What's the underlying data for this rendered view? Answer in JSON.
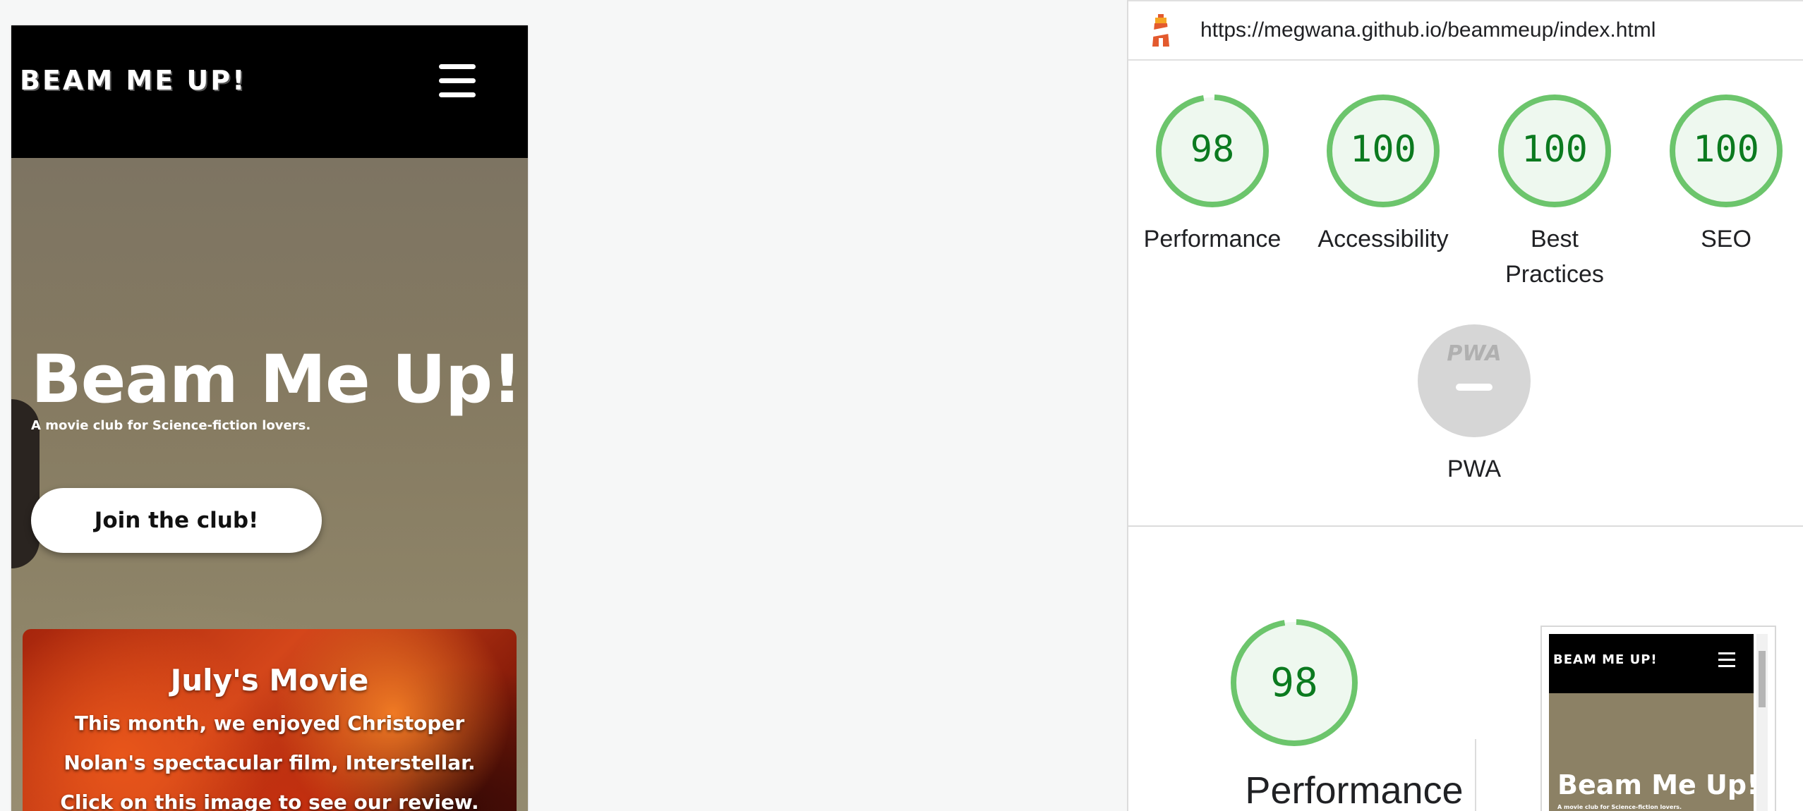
{
  "site": {
    "logo": "BEAM ME UP!",
    "hero": {
      "title": "Beam Me Up!",
      "subtitle": "A movie club for Science-fiction lovers.",
      "cta_label": "Join the club!"
    },
    "movie_card": {
      "title": "July's Movie",
      "text": "This month, we enjoyed Christoper Nolan's spectacular film, Interstellar. Click on this image to see our review."
    }
  },
  "report": {
    "url": "https://megwana.github.io/beammeup/index.html",
    "gauges": [
      {
        "label": "Performance",
        "score": "98",
        "value": 98
      },
      {
        "label": "Accessibility",
        "score": "100",
        "value": 100
      },
      {
        "label": "Best Practices",
        "score": "100",
        "value": 100
      },
      {
        "label": "SEO",
        "score": "100",
        "value": 100
      }
    ],
    "pwa": {
      "label": "PWA",
      "badge": "PWA"
    },
    "summary": {
      "label": "Performance",
      "score": "98",
      "value": 98
    },
    "thumbnail": {
      "logo": "BEAM ME UP!",
      "title": "Beam Me Up!",
      "subtitle": "A movie club for Science-fiction lovers."
    },
    "colors": {
      "pass_ring": "#6cc56c",
      "pass_fill": "#eef8ef",
      "pass_text": "#0b7a1f",
      "pwa_gray": "#d6d6d6"
    }
  }
}
